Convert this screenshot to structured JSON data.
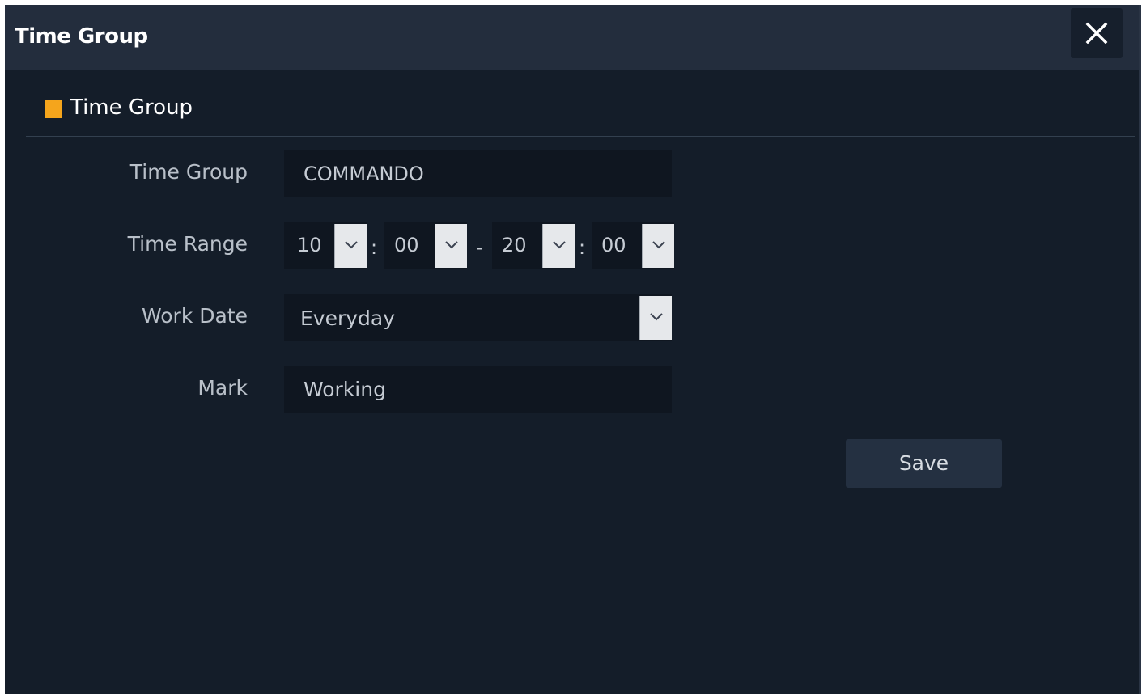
{
  "window": {
    "title": "Time Group",
    "close_icon": "close-icon"
  },
  "section": {
    "title": "Time Group",
    "marker_color": "#f5a51c"
  },
  "form": {
    "time_group": {
      "label": "Time Group",
      "value": "COMMANDO"
    },
    "time_range": {
      "label": "Time Range",
      "start_hour": "10",
      "start_minute": "00",
      "end_hour": "20",
      "end_minute": "00",
      "colon": ":",
      "dash": "-"
    },
    "work_date": {
      "label": "Work Date",
      "value": "Everyday"
    },
    "mark": {
      "label": "Mark",
      "value": "Working"
    }
  },
  "actions": {
    "save_label": "Save"
  },
  "colors": {
    "background": "#141d29",
    "titlebar": "#232d3d",
    "input_bg": "#0f1620",
    "accent": "#f5a51c"
  }
}
